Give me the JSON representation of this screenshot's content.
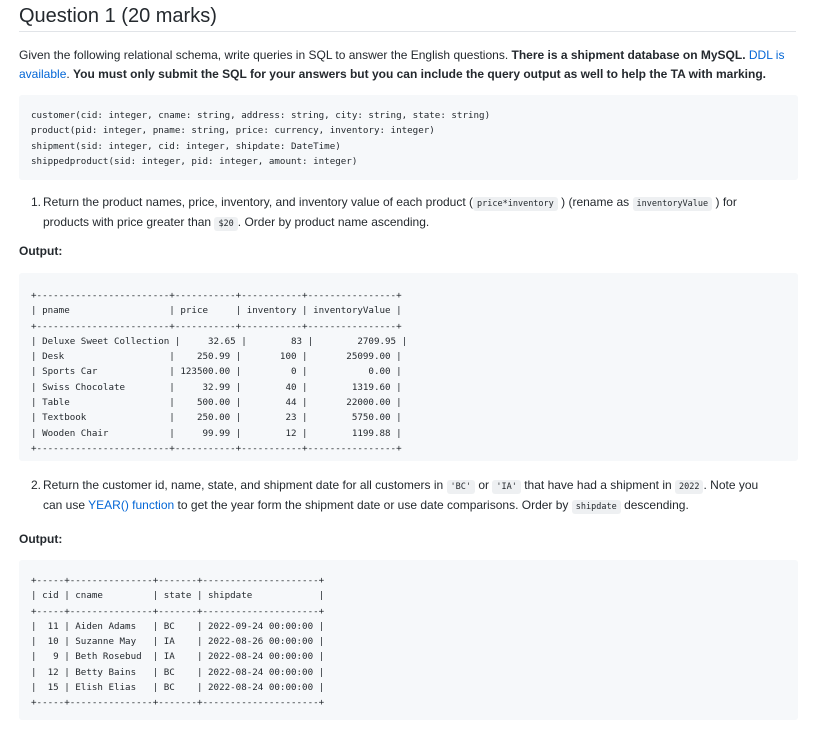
{
  "title": "Question 1 (20 marks)",
  "intro": {
    "part1": "Given the following relational schema, write queries in SQL to answer the English questions. ",
    "bold1": "There is a shipment database on MySQL. ",
    "link": "DDL is available",
    "part2": ". ",
    "bold2": "You must only submit the SQL for your answers but you can include the query output as well to help the TA with marking."
  },
  "schema": [
    "customer(cid: integer, cname: string, address: string, city: string, state: string)",
    "product(pid: integer, pname: string, price: currency, inventory: integer)",
    "shipment(sid: integer, cid: integer, shipdate: DateTime)",
    "shippedproduct(sid: integer, pid: integer, amount: integer)"
  ],
  "q1": {
    "number": "1.",
    "line1_a": "Return the product names, price, inventory, and inventory value of each product (",
    "code_a": "price*inventory",
    "line1_b": ") (rename as",
    "code_b": "inventoryValue",
    "line1_c": ") for",
    "line2_a": "products with price greater than",
    "code_c": "$20",
    "line2_b": ". Order by product name ascending."
  },
  "output_label": "Output:",
  "table1": {
    "border": "+------------------------+-----------+-----------+----------------+",
    "header": "| pname                  | price     | inventory | inventoryValue |",
    "rows": [
      "| Deluxe Sweet Collection |     32.65 |        83 |        2709.95 |",
      "| Desk                   |    250.99 |       100 |       25099.00 |",
      "| Sports Car             | 123500.00 |         0 |           0.00 |",
      "| Swiss Chocolate        |     32.99 |        40 |        1319.60 |",
      "| Table                  |    500.00 |        44 |       22000.00 |",
      "| Textbook               |    250.00 |        23 |        5750.00 |",
      "| Wooden Chair           |     99.99 |        12 |        1199.88 |"
    ]
  },
  "q2": {
    "number": "2.",
    "line1_a": "Return the customer id, name, state, and shipment date for all customers in",
    "code_a": "'BC'",
    "line1_b": "or",
    "code_b": "'IA'",
    "line1_c": "that have had a shipment in",
    "code_c": "2022",
    "line1_d": ". Note you",
    "line2_a": "can use",
    "link": "YEAR() function",
    "line2_b": "to get the year form the shipment date or use date comparisons. Order by",
    "code_d": "shipdate",
    "line2_c": "descending."
  },
  "table2": {
    "border": "+-----+---------------+-------+---------------------+",
    "header": "| cid | cname         | state | shipdate            |",
    "rows": [
      "|  11 | Aiden Adams   | BC    | 2022-09-24 00:00:00 |",
      "|  10 | Suzanne May   | IA    | 2022-08-26 00:00:00 |",
      "|   9 | Beth Rosebud  | IA    | 2022-08-24 00:00:00 |",
      "|  12 | Betty Bains   | BC    | 2022-08-24 00:00:00 |",
      "|  15 | Elish Elias   | BC    | 2022-08-24 00:00:00 |"
    ]
  }
}
